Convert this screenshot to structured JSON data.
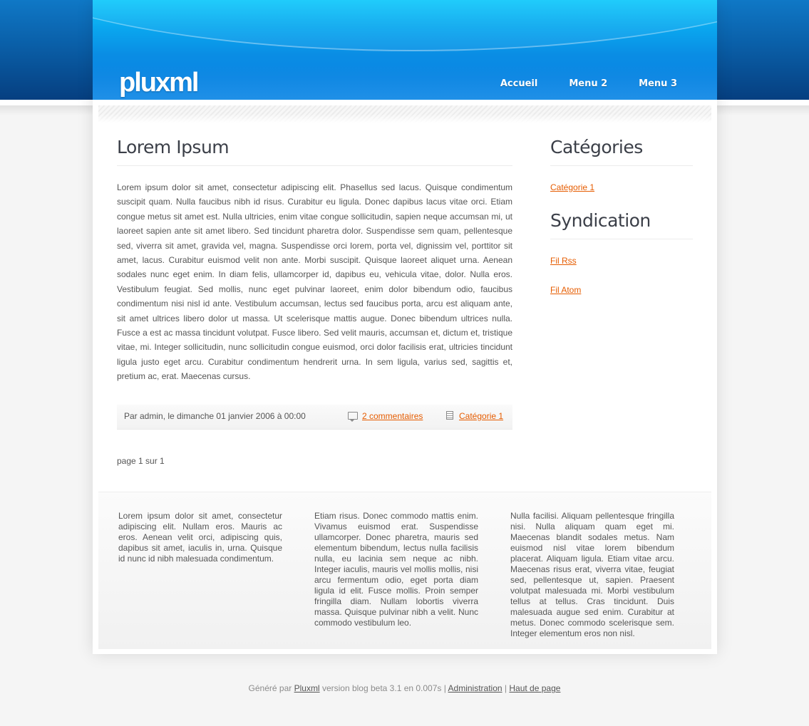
{
  "header": {
    "logo": "pluxml",
    "nav": [
      "Accueil",
      "Menu 2",
      "Menu 3"
    ]
  },
  "post": {
    "title": "Lorem Ipsum",
    "body": "Lorem ipsum dolor sit amet, consectetur adipiscing elit. Phasellus sed lacus. Quisque condimentum suscipit quam. Nulla faucibus nibh id risus. Curabitur eu ligula. Donec dapibus lacus vitae orci. Etiam congue metus sit amet est. Nulla ultricies, enim vitae congue sollicitudin, sapien neque accumsan mi, ut laoreet sapien ante sit amet libero. Sed tincidunt pharetra dolor. Suspendisse sem quam, pellentesque sed, viverra sit amet, gravida vel, magna. Suspendisse orci lorem, porta vel, dignissim vel, porttitor sit amet, lacus. Curabitur euismod velit non ante. Morbi suscipit. Quisque laoreet aliquet urna. Aenean sodales nunc eget enim. In diam felis, ullamcorper id, dapibus eu, vehicula vitae, dolor. Nulla eros. Vestibulum feugiat. Sed mollis, nunc eget pulvinar laoreet, enim dolor bibendum odio, faucibus condimentum nisi nisl id ante. Vestibulum accumsan, lectus sed faucibus porta, arcu est aliquam ante, sit amet ultrices libero dolor ut massa. Ut scelerisque mattis augue. Donec bibendum ultrices nulla. Fusce a est ac massa tincidunt volutpat. Fusce libero. Sed velit mauris, accumsan et, dictum et, tristique vitae, mi. Integer sollicitudin, nunc sollicitudin congue euismod, orci dolor facilisis erat, ultricies tincidunt ligula justo eget arcu. Curabitur condimentum hendrerit urna. In sem ligula, varius sed, sagittis et, pretium ac, erat. Maecenas cursus.",
    "author_line": "Par admin, le dimanche 01 janvier 2006 à 00:00",
    "comments_link": "2 commentaires",
    "category_link": "Catégorie 1",
    "comments_icon": "comment-icon",
    "category_icon": "document-icon"
  },
  "pagination": "page 1 sur 1",
  "sidebar": {
    "categories_title": "Catégories",
    "categories": [
      "Catégorie 1"
    ],
    "syndication_title": "Syndication",
    "feeds": [
      "Fil Rss",
      "Fil Atom"
    ]
  },
  "footer_columns": [
    "Lorem ipsum dolor sit amet, consectetur adipiscing elit. Nullam eros. Mauris ac eros. Aenean velit orci, adipiscing quis, dapibus sit amet, iaculis in, urna. Quisque id nunc id nibh malesuada condimentum.",
    "Etiam risus. Donec commodo mattis enim. Vivamus euismod erat. Suspendisse ullamcorper. Donec pharetra, mauris sed elementum bibendum, lectus nulla facilisis nulla, eu lacinia sem neque ac nibh. Integer iaculis, mauris vel mollis mollis, nisi arcu fermentum odio, eget porta diam ligula id elit. Fusce mollis. Proin semper fringilla diam. Nullam lobortis viverra massa. Quisque pulvinar nibh a velit. Nunc commodo vestibulum leo.",
    "Nulla facilisi. Aliquam pellentesque fringilla nisi. Nulla aliquam quam eget mi. Maecenas blandit sodales metus. Nam euismod nisl vitae lorem bibendum placerat. Aliquam ligula. Etiam vitae arcu. Maecenas risus erat, viverra vitae, feugiat sed, pellentesque ut, sapien. Praesent volutpat malesuada mi. Morbi vestibulum tellus at tellus. Cras tincidunt. Duis malesuada augue sed enim. Curabitur at metus. Donec commodo scelerisque sem. Integer elementum eros non nisl."
  ],
  "credits": {
    "prefix": "Généré par",
    "pluxml_link": "Pluxml",
    "version_text": "version blog beta 3.1 en 0.007s |",
    "admin_link": "Administration",
    "separator": "|",
    "top_link": "Haut de page"
  },
  "colors": {
    "link": "#e65c00",
    "header_blue": "#0a8de4",
    "title_text": "#3b3f48"
  }
}
